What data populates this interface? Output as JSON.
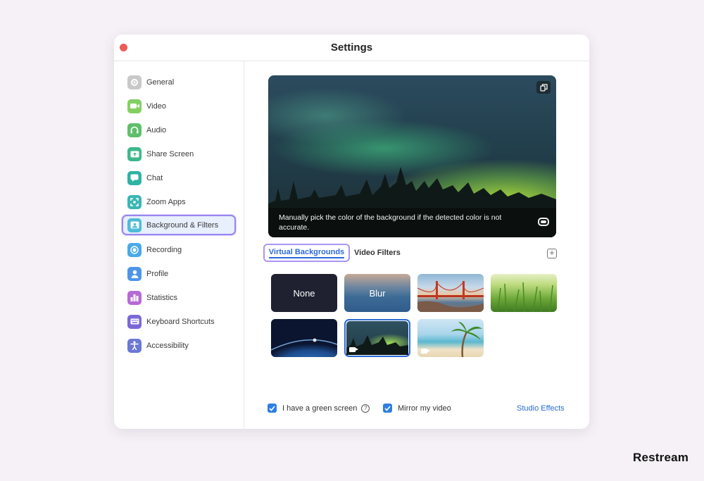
{
  "window": {
    "title": "Settings"
  },
  "sidebar": {
    "items": [
      {
        "label": "General",
        "icon": "gear-icon",
        "color": "#c4c4c4",
        "active": false
      },
      {
        "label": "Video",
        "icon": "video-camera-icon",
        "color": "#7fcf5c",
        "active": false
      },
      {
        "label": "Audio",
        "icon": "headphones-icon",
        "color": "#5fbf6a",
        "active": false
      },
      {
        "label": "Share Screen",
        "icon": "share-screen-icon",
        "color": "#3db88a",
        "active": false
      },
      {
        "label": "Chat",
        "icon": "chat-bubble-icon",
        "color": "#2fb3a3",
        "active": false
      },
      {
        "label": "Zoom Apps",
        "icon": "apps-icon",
        "color": "#3bb7b4",
        "active": false
      },
      {
        "label": "Background & Filters",
        "icon": "portrait-icon",
        "color": "#4dbcd7",
        "active": true
      },
      {
        "label": "Recording",
        "icon": "record-icon",
        "color": "#4aa9e9",
        "active": false
      },
      {
        "label": "Profile",
        "icon": "person-icon",
        "color": "#4d95e8",
        "active": false
      },
      {
        "label": "Statistics",
        "icon": "bar-chart-icon",
        "color": "#b66ad6",
        "active": false
      },
      {
        "label": "Keyboard Shortcuts",
        "icon": "keyboard-icon",
        "color": "#7b68d8",
        "active": false
      },
      {
        "label": "Accessibility",
        "icon": "accessibility-icon",
        "color": "#6a78d6",
        "active": false
      }
    ]
  },
  "preview": {
    "message": "Manually pick the color of the background if the detected color is not accurate."
  },
  "tabs": {
    "virtual_backgrounds": "Virtual Backgrounds",
    "video_filters": "Video Filters"
  },
  "backgrounds": {
    "none_label": "None",
    "blur_label": "Blur",
    "items": [
      "golden-gate-bridge",
      "grass",
      "earth-from-space",
      "northern-lights",
      "beach-palm"
    ],
    "selected": "northern-lights"
  },
  "options": {
    "green_screen": {
      "label": "I have a green screen",
      "checked": true
    },
    "mirror": {
      "label": "Mirror my video",
      "checked": true
    },
    "studio_effects": "Studio Effects"
  },
  "brand": "Restream",
  "colors": {
    "accent": "#2a6ad6",
    "focus_ring": "#9a86f0",
    "close": "#ec5b55"
  }
}
